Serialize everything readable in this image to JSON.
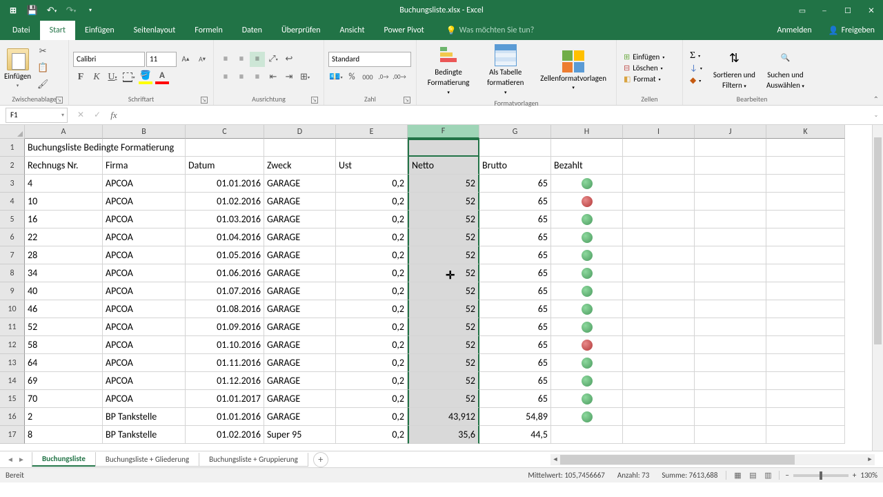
{
  "title": "Buchungsliste.xlsx - Excel",
  "tabs": {
    "file": "Datei",
    "home": "Start",
    "insert": "Einfügen",
    "layout": "Seitenlayout",
    "formulas": "Formeln",
    "data": "Daten",
    "review": "Überprüfen",
    "view": "Ansicht",
    "powerpivot": "Power Pivot"
  },
  "tell_me": "Was möchten Sie tun?",
  "signin": "Anmelden",
  "share": "Freigeben",
  "ribbon": {
    "clipboard": {
      "paste": "Einfügen",
      "label": "Zwischenablage"
    },
    "font": {
      "name": "Calibri",
      "size": "11",
      "label": "Schriftart"
    },
    "alignment": {
      "label": "Ausrichtung"
    },
    "number": {
      "format": "Standard",
      "label": "Zahl"
    },
    "styles": {
      "cond": "Bedingte Formatierung",
      "cond1": "Bedingte",
      "cond2": "Formatierung",
      "table": "Als Tabelle formatieren",
      "table1": "Als Tabelle",
      "table2": "formatieren",
      "cellstyles": "Zellenformatvorlagen",
      "label": "Formatvorlagen"
    },
    "cells": {
      "insert": "Einfügen",
      "delete": "Löschen",
      "format": "Format",
      "label": "Zellen"
    },
    "editing": {
      "sort": "Sortieren und Filtern",
      "sort1": "Sortieren und",
      "sort2": "Filtern",
      "find": "Suchen und Auswählen",
      "find1": "Suchen und",
      "find2": "Auswählen",
      "label": "Bearbeiten"
    }
  },
  "namebox": "F1",
  "columns": [
    "A",
    "B",
    "C",
    "D",
    "E",
    "F",
    "G",
    "H",
    "I",
    "J",
    "K"
  ],
  "selected_col_index": 5,
  "headers": {
    "title": "Buchungsliste Bedingte Formatierung",
    "a": "Rechnugs Nr.",
    "b": "Firma",
    "c": "Datum",
    "d": "Zweck",
    "e": "Ust",
    "f": "Netto",
    "g": "Brutto",
    "h": "Bezahlt"
  },
  "rows": [
    {
      "n": 3,
      "a": "4",
      "b": "APCOA",
      "c": "01.01.2016",
      "d": "GARAGE",
      "e": "0,2",
      "f": "52",
      "g": "65",
      "h": "green"
    },
    {
      "n": 4,
      "a": "10",
      "b": "APCOA",
      "c": "01.02.2016",
      "d": "GARAGE",
      "e": "0,2",
      "f": "52",
      "g": "65",
      "h": "red"
    },
    {
      "n": 5,
      "a": "16",
      "b": "APCOA",
      "c": "01.03.2016",
      "d": "GARAGE",
      "e": "0,2",
      "f": "52",
      "g": "65",
      "h": "green"
    },
    {
      "n": 6,
      "a": "22",
      "b": "APCOA",
      "c": "01.04.2016",
      "d": "GARAGE",
      "e": "0,2",
      "f": "52",
      "g": "65",
      "h": "green"
    },
    {
      "n": 7,
      "a": "28",
      "b": "APCOA",
      "c": "01.05.2016",
      "d": "GARAGE",
      "e": "0,2",
      "f": "52",
      "g": "65",
      "h": "green"
    },
    {
      "n": 8,
      "a": "34",
      "b": "APCOA",
      "c": "01.06.2016",
      "d": "GARAGE",
      "e": "0,2",
      "f": "52",
      "g": "65",
      "h": "green"
    },
    {
      "n": 9,
      "a": "40",
      "b": "APCOA",
      "c": "01.07.2016",
      "d": "GARAGE",
      "e": "0,2",
      "f": "52",
      "g": "65",
      "h": "green"
    },
    {
      "n": 10,
      "a": "46",
      "b": "APCOA",
      "c": "01.08.2016",
      "d": "GARAGE",
      "e": "0,2",
      "f": "52",
      "g": "65",
      "h": "green"
    },
    {
      "n": 11,
      "a": "52",
      "b": "APCOA",
      "c": "01.09.2016",
      "d": "GARAGE",
      "e": "0,2",
      "f": "52",
      "g": "65",
      "h": "green"
    },
    {
      "n": 12,
      "a": "58",
      "b": "APCOA",
      "c": "01.10.2016",
      "d": "GARAGE",
      "e": "0,2",
      "f": "52",
      "g": "65",
      "h": "red"
    },
    {
      "n": 13,
      "a": "64",
      "b": "APCOA",
      "c": "01.11.2016",
      "d": "GARAGE",
      "e": "0,2",
      "f": "52",
      "g": "65",
      "h": "green"
    },
    {
      "n": 14,
      "a": "69",
      "b": "APCOA",
      "c": "01.12.2016",
      "d": "GARAGE",
      "e": "0,2",
      "f": "52",
      "g": "65",
      "h": "green"
    },
    {
      "n": 15,
      "a": "70",
      "b": "APCOA",
      "c": "01.01.2017",
      "d": "GARAGE",
      "e": "0,2",
      "f": "52",
      "g": "65",
      "h": "green"
    },
    {
      "n": 16,
      "a": "2",
      "b": "BP Tankstelle",
      "c": "01.01.2016",
      "d": "GARAGE",
      "e": "0,2",
      "f": "43,912",
      "g": "54,89",
      "h": "green"
    },
    {
      "n": 17,
      "a": "8",
      "b": "BP Tankstelle",
      "c": "01.02.2016",
      "d": "Super 95",
      "e": "0,2",
      "f": "35,6",
      "g": "44,5",
      "h": ""
    }
  ],
  "sheets": {
    "s1": "Buchungsliste",
    "s2": "Buchungsliste + Gliederung",
    "s3": "Buchungsliste + Gruppierung"
  },
  "status": {
    "ready": "Bereit",
    "avg_label": "Mittelwert:",
    "avg": "105,7456667",
    "count_label": "Anzahl:",
    "count": "73",
    "sum_label": "Summe:",
    "sum": "7613,688",
    "zoom": "130%"
  }
}
